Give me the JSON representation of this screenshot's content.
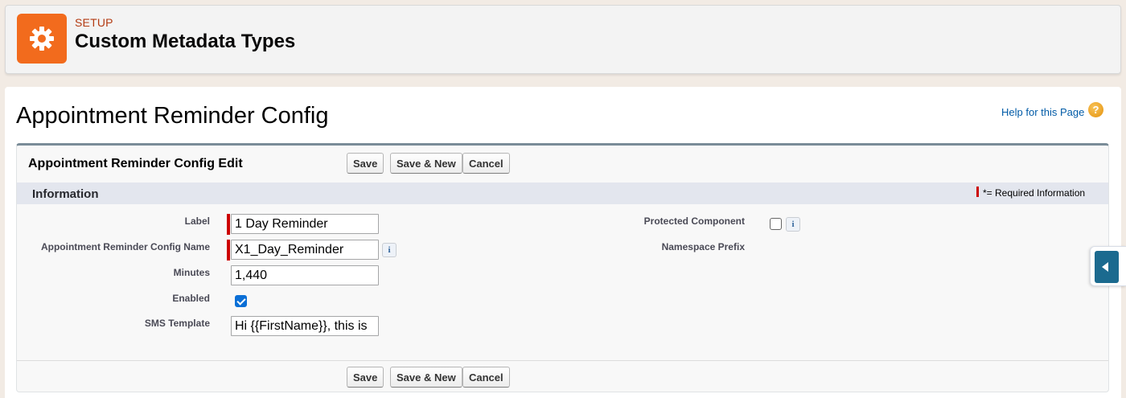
{
  "header": {
    "eyebrow": "SETUP",
    "title": "Custom Metadata Types",
    "icon": "gear-icon"
  },
  "page": {
    "title": "Appointment Reminder Config",
    "help_link": "Help for this Page",
    "help_icon": "?"
  },
  "edit_block": {
    "title": "Appointment Reminder Config Edit",
    "buttons": {
      "save": "Save",
      "save_new": "Save & New",
      "cancel": "Cancel"
    }
  },
  "section": {
    "title": "Information",
    "required_legend": "*= Required Information"
  },
  "fields": {
    "label": {
      "label": "Label",
      "value": "1 Day Reminder",
      "required": true
    },
    "config_name": {
      "label": "Appointment Reminder Config Name",
      "value": "X1_Day_Reminder",
      "required": true
    },
    "minutes": {
      "label": "Minutes",
      "value": "1,440"
    },
    "enabled": {
      "label": "Enabled",
      "checked": true
    },
    "sms_template": {
      "label": "SMS Template",
      "value": "Hi {{FirstName}}, this is"
    },
    "protected_component": {
      "label": "Protected Component",
      "checked": false
    },
    "namespace_prefix": {
      "label": "Namespace Prefix"
    }
  },
  "info_icon": "i",
  "colors": {
    "brand_orange": "#f26b1d",
    "required_red": "#cc0000",
    "link_blue": "#015ba7",
    "checkbox_blue": "#0b6fd6",
    "side_tab": "#1b6a8f"
  }
}
